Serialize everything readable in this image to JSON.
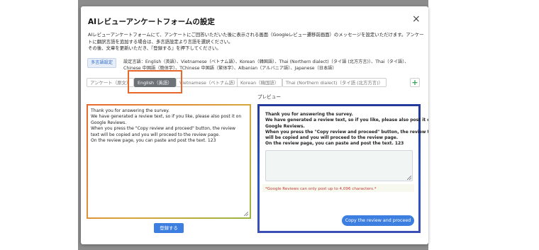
{
  "modal": {
    "title": "AIレビューアンケートフォームの設定",
    "close_glyph": "×",
    "description": [
      "AIレビューアンケートフォームにて、アンケートにご回答いただいた後に表示される画面（Googleレビュー遷移前画面）のメッセージを設定いただけます。アンケー",
      "トに翻訳言語を追加する場合は、多言語設定より言語を選択ください。",
      "その後、文章を更新いただき、『登録する』を押下してください。"
    ]
  },
  "multilang": {
    "button_label": "多言語設定",
    "languages_text": [
      "設定言語：English（英語）、Vietnamese（ベトナム語）、Korean（韓国語）、Thai (Northern dialect)（タイ語 (北方方言)）、Thai（タイ語）、",
      "Chinese 中国語（簡体字）、TChinese 中国語（繁体字）、Albanian（アルバニア語）、Japanese（日本語）"
    ]
  },
  "tabs": [
    {
      "label": "アンケート（原文）",
      "active": false
    },
    {
      "label": "English（英語）",
      "active": true
    },
    {
      "label": "Vietnamese（ベトナム語）",
      "active": false
    },
    {
      "label": "Korean（韓国語）",
      "active": false
    },
    {
      "label": "Thai (Northern dialect)（タイ語 (北方方言)）",
      "active": false
    }
  ],
  "add_tab_glyph": "+",
  "preview_label": "プレビュー",
  "editor": {
    "lines": [
      "Thank you for answering the survey.",
      "We have generated a review text, so if you like, please also post it on",
      "Google Reviews.",
      "When you press the \"Copy review and proceed\" button, the review",
      "text will be copied and you will proceed to the review page.",
      "On the review page, you can paste and post the text. 123"
    ]
  },
  "preview": {
    "lines": [
      "Thank you for answering the survey.",
      "We have generated a review text, so if you like, please also post it on",
      "Google Reviews.",
      "When you press the \"Copy review and proceed\" button, the review text",
      "will be copied and you will proceed to the review page.",
      "On the review page, you can paste and post the text. 123"
    ],
    "note": "*Google Reviews can only post up to 4,096 characters.*",
    "proceed_button": "Copy the review and proceed"
  },
  "register_button": "登録する",
  "colors": {
    "accent_blue": "#3d7fe0",
    "highlight_orange": "#e8682c",
    "preview_border": "#253a9a",
    "note_red": "#c23a3a"
  }
}
